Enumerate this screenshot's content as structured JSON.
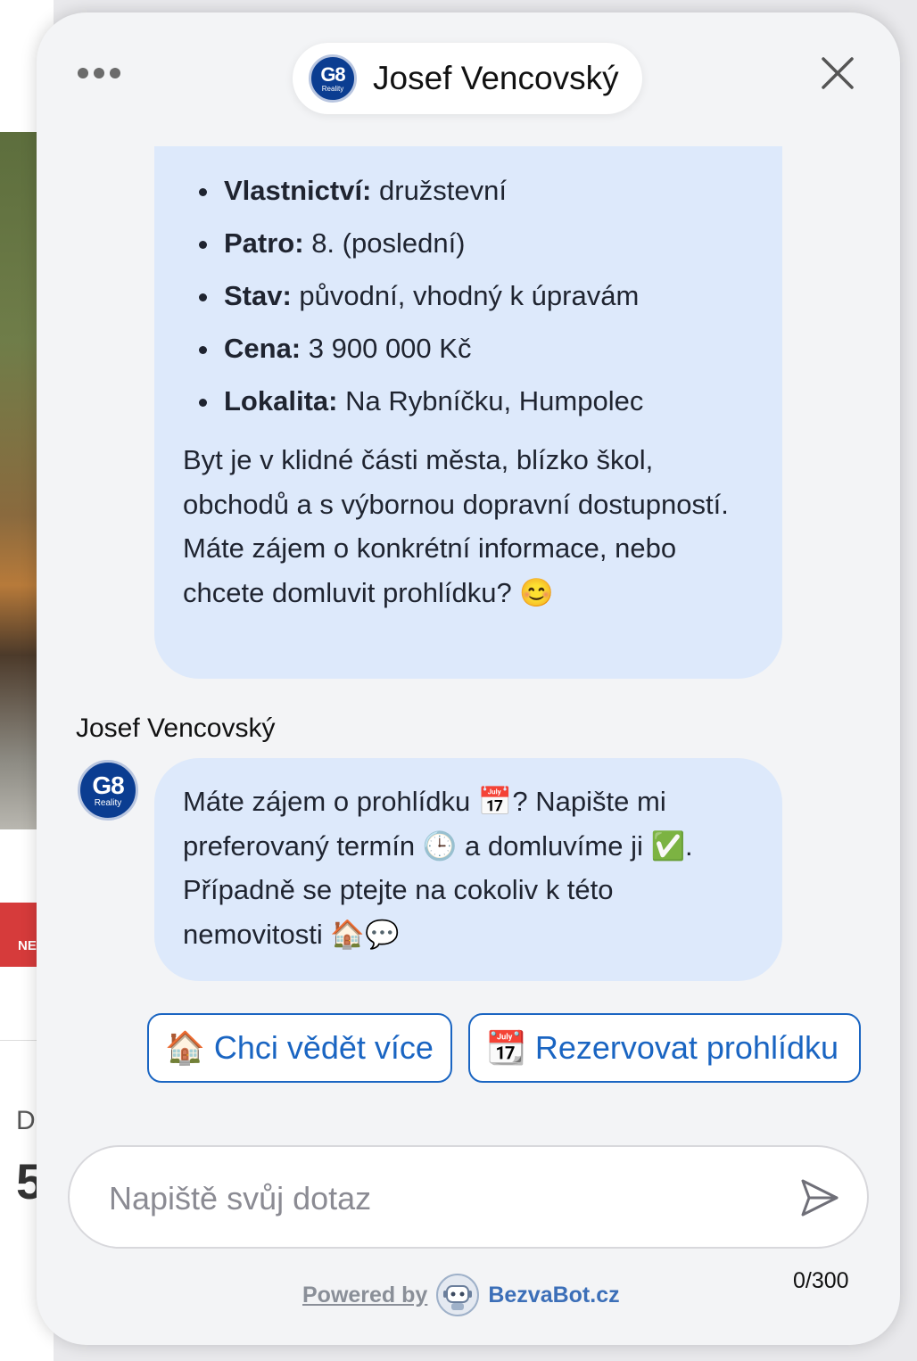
{
  "background": {
    "badge_text": "NE",
    "label_fragment": "D",
    "number_fragment": "5"
  },
  "header": {
    "title": "Josef Vencovský",
    "logo_text": "G8",
    "logo_subtext": "Reality"
  },
  "messages": [
    {
      "list": [
        {
          "label": "Vlastnictví:",
          "value": " družstevní"
        },
        {
          "label": "Patro:",
          "value": " 8. (poslední)"
        },
        {
          "label": "Stav:",
          "value": " původní, vhodný k úpravám"
        },
        {
          "label": "Cena:",
          "value": " 3 900 000 Kč"
        },
        {
          "label": "Lokalita:",
          "value": " Na Rybníčku, Humpolec"
        }
      ],
      "text": "Byt je v klidné části města, blízko škol, obchodů a s výbornou dopravní dostupností. Máte zájem o konkrétní informace, nebo chcete domluvit prohlídku? 😊"
    },
    {
      "sender": "Josef Vencovský",
      "text": "Máte zájem o prohlídku 📅? Napište mi preferovaný termín 🕒 a domluvíme ji ✅. Případně se ptejte na cokoliv k této nemovitosti 🏠💬"
    }
  ],
  "quick_replies": [
    {
      "label": "🏠 Chci vědět více"
    },
    {
      "label": "📆 Rezervovat prohlídku"
    }
  ],
  "composer": {
    "placeholder": "Napiště svůj dotaz",
    "value": "",
    "char_counter": "0/300"
  },
  "footer": {
    "powered_label": "Powered by",
    "brand": "BezvaBot.cz"
  },
  "icons": {
    "menu": "more-horizontal-icon",
    "close": "close-icon",
    "send": "send-icon",
    "bot": "bezvabot-robot-icon"
  },
  "colors": {
    "accent": "#1a65c2",
    "bubble": "#dde9fb",
    "logo": "#0b3d91"
  }
}
